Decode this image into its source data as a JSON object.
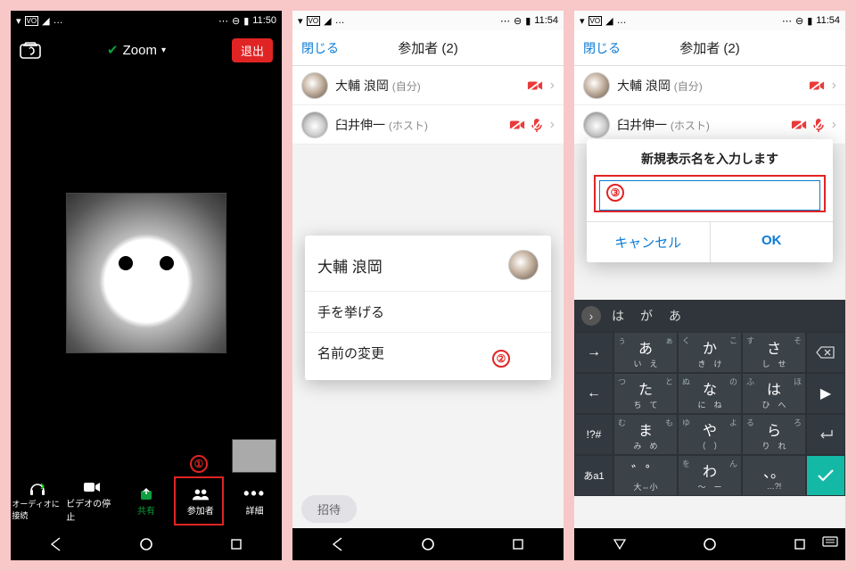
{
  "screen1": {
    "status_time": "11:50",
    "header_title": "Zoom",
    "leave_label": "退出",
    "toolbar": {
      "audio": "オーディオに接続",
      "video": "ビデオの停止",
      "share": "共有",
      "participants": "参加者",
      "more": "詳細"
    },
    "annotation_number": "①"
  },
  "screen2": {
    "status_time": "11:54",
    "close_label": "閉じる",
    "title": "参加者 (2)",
    "participants": [
      {
        "name": "大輔 浪岡",
        "tag": "(自分)"
      },
      {
        "name": "臼井伸一",
        "tag": "(ホスト)"
      }
    ],
    "invite_label": "招待",
    "sheet": {
      "name": "大輔 浪岡",
      "raise_hand": "手を挙げる",
      "rename": "名前の変更"
    },
    "annotation_number": "②"
  },
  "screen3": {
    "status_time": "11:54",
    "close_label": "閉じる",
    "title": "参加者 (2)",
    "participants": [
      {
        "name": "大輔 浪岡",
        "tag": "(自分)"
      },
      {
        "name": "臼井伸一",
        "tag": "(ホスト)"
      }
    ],
    "dialog": {
      "title": "新規表示名を入力します",
      "cancel": "キャンセル",
      "ok": "OK"
    },
    "annotation_number": "③",
    "keyboard": {
      "suggestions": [
        "は",
        "が",
        "あ"
      ],
      "row1": [
        {
          "fn": "→"
        },
        {
          "small_l": "ぅ",
          "main": "あ",
          "small_r": "ぁ",
          "sub_bl": "い",
          "sub_br": "え"
        },
        {
          "small_l": "く",
          "main": "か",
          "small_r": "こ",
          "sub_bl": "き",
          "sub_br": "け"
        },
        {
          "small_l": "す",
          "main": "さ",
          "small_r": "そ",
          "sub_bl": "し",
          "sub_br": "せ"
        },
        {
          "fn": "⌫"
        }
      ],
      "row2": [
        {
          "fn": "←"
        },
        {
          "small_l": "つ",
          "main": "た",
          "small_r": "と",
          "sub_bl": "ち",
          "sub_br": "て"
        },
        {
          "small_l": "ぬ",
          "main": "な",
          "small_r": "の",
          "sub_bl": "に",
          "sub_br": "ね"
        },
        {
          "small_l": "ふ",
          "main": "は",
          "small_r": "ほ",
          "sub_bl": "ひ",
          "sub_br": "へ"
        },
        {
          "fn": "▶"
        }
      ],
      "row3": [
        {
          "fn": "!?#"
        },
        {
          "small_l": "む",
          "main": "ま",
          "small_r": "も",
          "sub_bl": "み",
          "sub_br": "め"
        },
        {
          "small_l": "ゆ",
          "main": "や",
          "small_r": "よ",
          "sub_bl": "（",
          "sub_br": "）"
        },
        {
          "small_l": "る",
          "main": "ら",
          "small_r": "ろ",
          "sub_bl": "り",
          "sub_br": "れ"
        },
        {
          "fn": "⏎"
        }
      ],
      "row4": [
        {
          "fn": "あa1"
        },
        {
          "main": "゛゜",
          "sub": "大⇔小"
        },
        {
          "small_l": "を",
          "main": "わ",
          "small_r": "ん",
          "sub_bl": "〜",
          "sub_br": "ー"
        },
        {
          "main": "、。",
          "sub": "…?!"
        },
        {
          "fn": "✓"
        }
      ]
    }
  }
}
